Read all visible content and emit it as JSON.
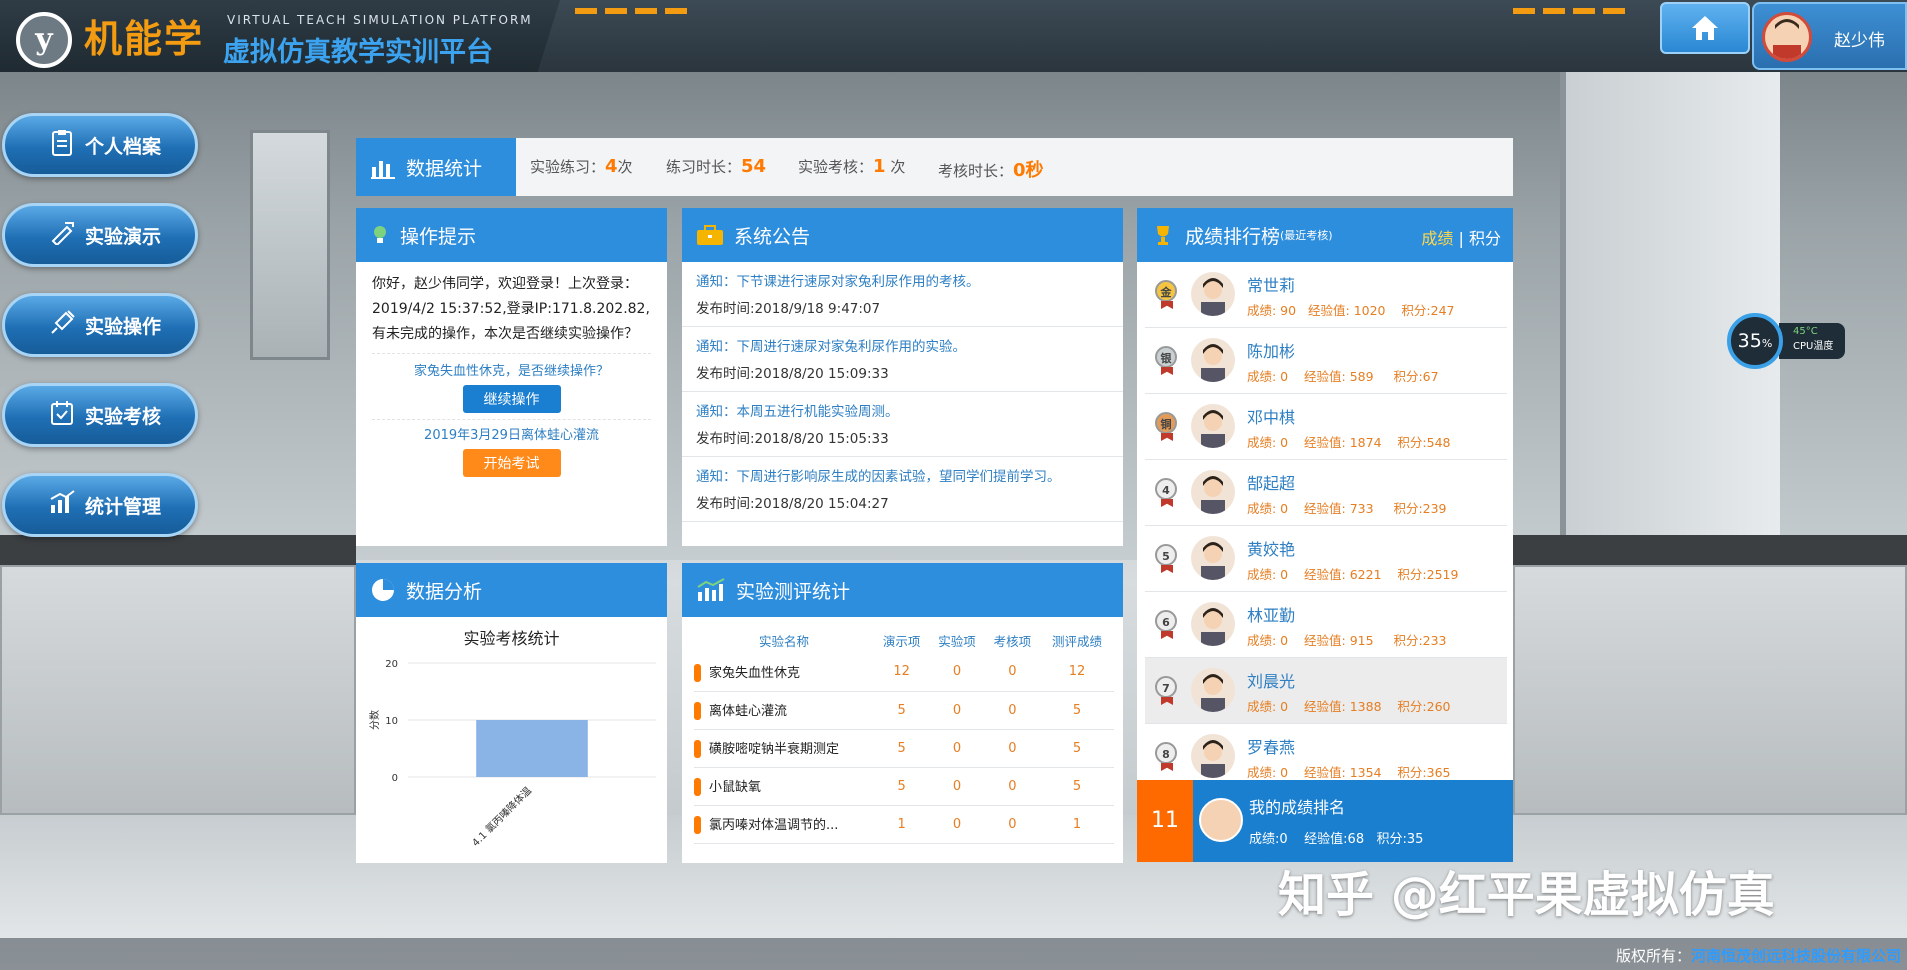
{
  "header": {
    "logo_letter": "y",
    "logo_cn": "机能学",
    "logo_en": "VIRTUAL TEACH SIMULATION PLATFORM",
    "logo_subtitle": "虚拟仿真教学实训平台",
    "user_name": "赵少伟"
  },
  "nav": {
    "items": [
      {
        "label": "个人档案",
        "icon": "profile-icon"
      },
      {
        "label": "实验演示",
        "icon": "demo-icon"
      },
      {
        "label": "实验操作",
        "icon": "syringe-icon"
      },
      {
        "label": "实验考核",
        "icon": "exam-icon"
      },
      {
        "label": "统计管理",
        "icon": "stats-icon"
      }
    ]
  },
  "stats": {
    "title": "数据统计",
    "practice_label": "实验练习：",
    "practice_value": "4",
    "practice_unit": "次",
    "duration_label": "练习时长：",
    "duration_value": "54",
    "exam_label": "实验考核：",
    "exam_value": "1",
    "exam_unit": " 次",
    "exam_duration_label": "考核时长：",
    "exam_duration_value": "0秒"
  },
  "tips": {
    "title": "操作提示",
    "message": "你好，赵少伟同学，欢迎登录！上次登录：2019/4/2 15:37:52,登录IP:171.8.202.82,有未完成的操作，本次是否继续实验操作？",
    "continue_question": "家兔失血性休克，是否继续操作？",
    "continue_button": "继续操作",
    "exam_item": "2019年3月29日离体蛙心灌流",
    "start_button": "开始考试"
  },
  "notices": {
    "title": "系统公告",
    "items": [
      {
        "text": "通知：下节课进行速尿对家兔利尿作用的考核。",
        "time": "发布时间:2018/9/18 9:47:07"
      },
      {
        "text": "通知：下周进行速尿对家兔利尿作用的实验。",
        "time": "发布时间:2018/8/20 15:09:33"
      },
      {
        "text": "通知：本周五进行机能实验周测。",
        "time": "发布时间:2018/8/20 15:05:33"
      },
      {
        "text": "通知：下周进行影响尿生成的因素试验，望同学们提前学习。",
        "time": "发布时间:2018/8/20 15:04:27"
      }
    ]
  },
  "ranking": {
    "title": "成绩排行榜",
    "title_note": "(最近考核)",
    "tab_score": "成绩",
    "tab_sep": "|",
    "tab_points": "积分",
    "rows": [
      {
        "rank": "金",
        "name": "常世莉",
        "stats": "成绩: 90   经验值: 1020    积分:247"
      },
      {
        "rank": "银",
        "name": "陈加彬",
        "stats": "成绩: 0    经验值: 589     积分:67"
      },
      {
        "rank": "铜",
        "name": "邓中棋",
        "stats": "成绩: 0    经验值: 1874    积分:548"
      },
      {
        "rank": "4",
        "name": "郜起超",
        "stats": "成绩: 0    经验值: 733     积分:239"
      },
      {
        "rank": "5",
        "name": "黄姣艳",
        "stats": "成绩: 0    经验值: 6221    积分:2519"
      },
      {
        "rank": "6",
        "name": "林亚勤",
        "stats": "成绩: 0    经验值: 915     积分:233"
      },
      {
        "rank": "7",
        "name": "刘晨光",
        "stats": "成绩: 0    经验值: 1388    积分:260"
      },
      {
        "rank": "8",
        "name": "罗春燕",
        "stats": "成绩: 0    经验值: 1354    积分:365"
      }
    ],
    "my_rank_number": "11",
    "my_rank_label": "我的成绩排名",
    "my_rank_stats": "成绩:0    经验值:68   积分:35"
  },
  "analysis": {
    "title": "数据分析"
  },
  "chart_data": {
    "type": "bar",
    "title": "实验考核统计",
    "ylabel": "分数",
    "xlabel": "",
    "categories": [
      "4.1 氯丙嗪降体温"
    ],
    "values": [
      10
    ],
    "ylim": [
      0,
      20
    ],
    "yticks": [
      0,
      10,
      20
    ],
    "bar_color": "#8ab4e6"
  },
  "evaluation": {
    "title": "实验测评统计",
    "columns": [
      "实验名称",
      "演示项",
      "实验项",
      "考核项",
      "测评成绩"
    ],
    "rows": [
      [
        "家兔失血性休克",
        "12",
        "0",
        "0",
        "12"
      ],
      [
        "离体蛙心灌流",
        "5",
        "0",
        "0",
        "5"
      ],
      [
        "磺胺嘧啶钠半衰期测定",
        "5",
        "0",
        "0",
        "5"
      ],
      [
        "小鼠缺氧",
        "5",
        "0",
        "0",
        "5"
      ],
      [
        "氯丙嗪对体温调节的...",
        "1",
        "0",
        "0",
        "1"
      ]
    ]
  },
  "cpu": {
    "percent": "35",
    "percent_unit": "%",
    "temperature": "45°C",
    "label": "CPU温度"
  },
  "footer": {
    "copyright_label": "版权所有：",
    "company": "河南恒茂创远科技股份有限公司",
    "watermark": "知乎 @红平果虚拟仿真"
  },
  "colors": {
    "primary": "#2e8ede",
    "accent": "#ff7a00",
    "link": "#2e7fc3"
  }
}
